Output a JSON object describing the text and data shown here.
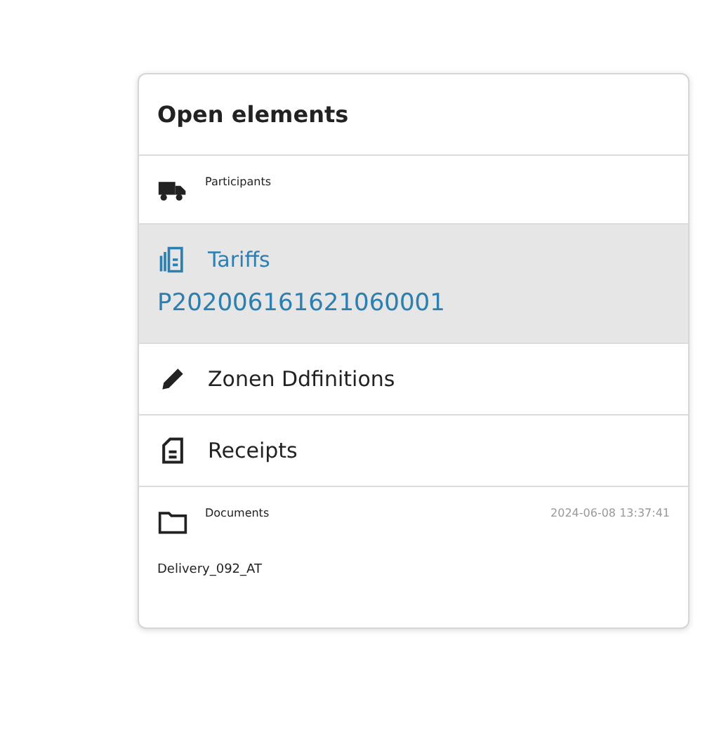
{
  "panel": {
    "title": "Open elements"
  },
  "items": [
    {
      "kind": "compact",
      "label": "Participants",
      "selected": false
    },
    {
      "kind": "large",
      "label": "Tariffs",
      "detail": "P202006161621060001",
      "selected": true
    },
    {
      "kind": "large",
      "label": "Zonen Ddfinitions",
      "selected": false
    },
    {
      "kind": "large",
      "label": "Receipts",
      "selected": false
    },
    {
      "kind": "compact",
      "label": "Documents",
      "time": "2024-06-08 13:37:41",
      "detail": "Delivery_092_AT",
      "selected": false
    }
  ]
}
